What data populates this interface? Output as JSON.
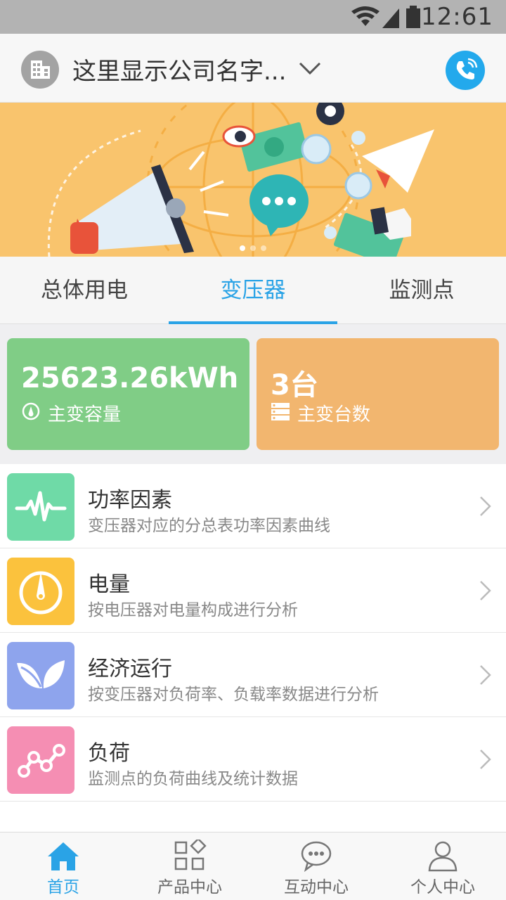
{
  "status_bar": {
    "time": "12:61"
  },
  "header": {
    "company_name": "这里显示公司名字..."
  },
  "tabs": [
    {
      "label": "总体用电"
    },
    {
      "label": "变压器"
    },
    {
      "label": "监测点"
    }
  ],
  "active_tab_index": 1,
  "stats": {
    "capacity": {
      "value": "25623.26kWh",
      "label": "主变容量"
    },
    "count": {
      "value": "3台",
      "label": "主变台数"
    }
  },
  "list": [
    {
      "title": "功率因素",
      "desc": "变压器对应的分总表功率因素曲线",
      "icon": "pulse-icon",
      "color": "#6fdaa7"
    },
    {
      "title": "电量",
      "desc": "按电压器对电量构成进行分析",
      "icon": "gauge-icon",
      "color": "#fbc23d"
    },
    {
      "title": "经济运行",
      "desc": "按变压器对负荷率、负载率数据进行分析",
      "icon": "leaf-icon",
      "color": "#8ea4ed"
    },
    {
      "title": "负荷",
      "desc": "监测点的负荷曲线及统计数据",
      "icon": "trend-icon",
      "color": "#f58eb3"
    }
  ],
  "bottom_nav": [
    {
      "label": "首页",
      "icon": "home-icon"
    },
    {
      "label": "产品中心",
      "icon": "grid-icon"
    },
    {
      "label": "互动中心",
      "icon": "chat-icon"
    },
    {
      "label": "个人中心",
      "icon": "user-icon"
    }
  ],
  "colors": {
    "accent": "#2aa3e6",
    "green_card": "#80cd86",
    "orange_card": "#f2b66f"
  }
}
